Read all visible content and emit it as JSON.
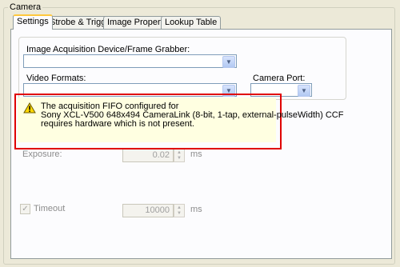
{
  "group": {
    "title": "Camera"
  },
  "tabs": [
    {
      "label": "Settings"
    },
    {
      "label": "Strobe & Trigger"
    },
    {
      "label": "Image Properties"
    },
    {
      "label": "Lookup Table"
    }
  ],
  "acquisition": {
    "label": "Image Acquisition Device/Frame Grabber:",
    "value": ""
  },
  "video_formats": {
    "label": "Video Formats:",
    "value": ""
  },
  "camera_port": {
    "label": "Camera Port:",
    "value": ""
  },
  "warning": {
    "icon": "warning-icon",
    "lines": [
      "The acquisition FIFO configured for",
      "Sony XCL-V500 648x494 CameraLink (8-bit, 1-tap, external-pulseWidth) CCF",
      "requires hardware which is not present."
    ]
  },
  "exposure": {
    "label": "Exposure:",
    "value": "0.02",
    "unit": "ms"
  },
  "timeout": {
    "label": "Timeout",
    "checked": true,
    "check_glyph": "✓",
    "value": "10000",
    "unit": "ms"
  }
}
